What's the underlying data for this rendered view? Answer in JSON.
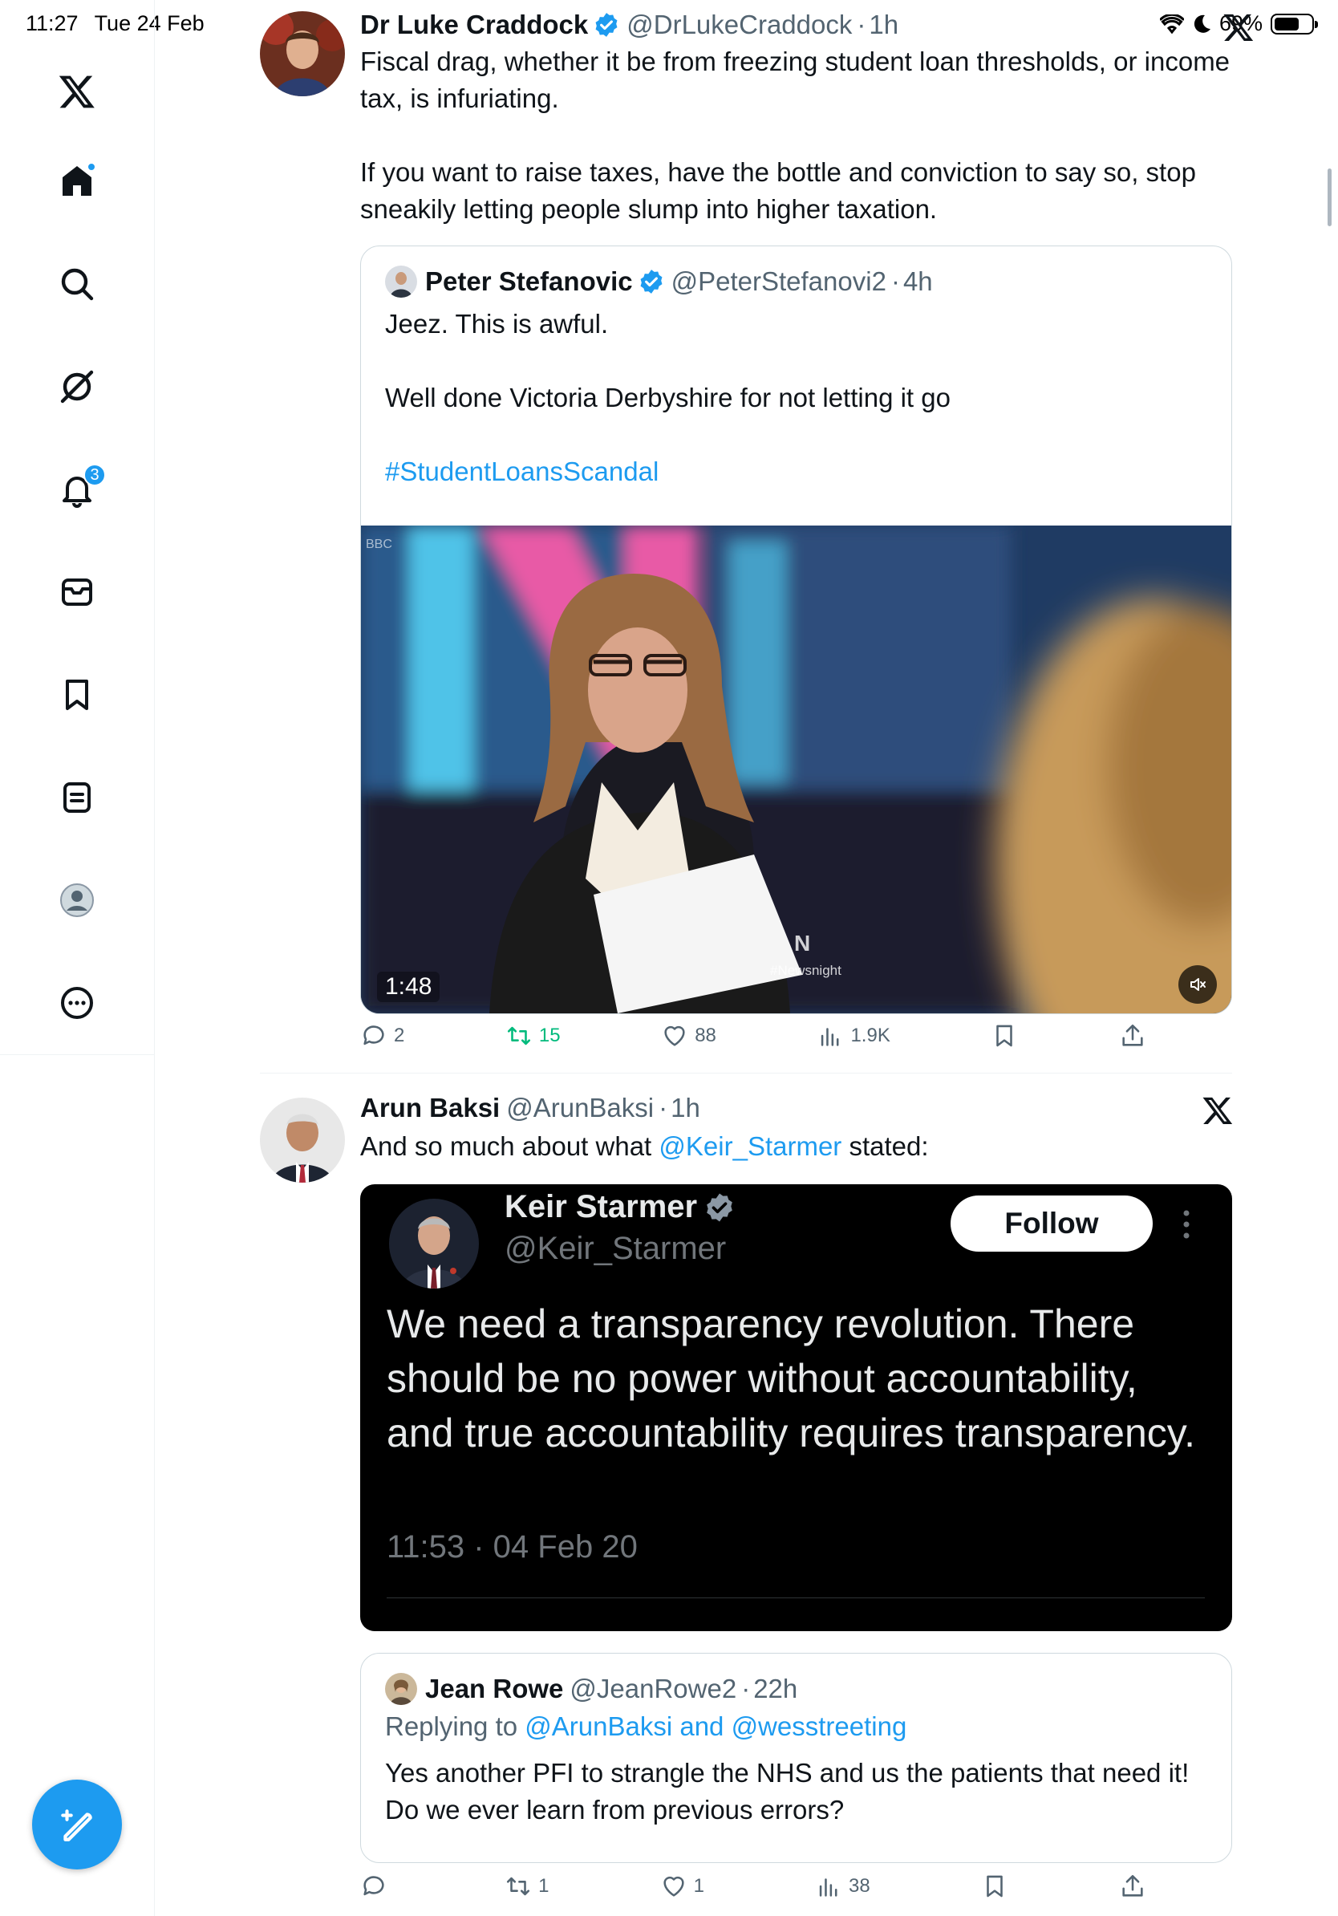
{
  "status_bar": {
    "time": "11:27",
    "date": "Tue 24 Feb",
    "battery": "69%",
    "battery_level": 0.69
  },
  "sidebar": {
    "items": [
      {
        "name": "x-logo"
      },
      {
        "name": "home",
        "has_dot": true
      },
      {
        "name": "search"
      },
      {
        "name": "grok"
      },
      {
        "name": "notifications",
        "badge": "3"
      },
      {
        "name": "messages"
      },
      {
        "name": "bookmarks"
      },
      {
        "name": "lists"
      },
      {
        "name": "profile"
      },
      {
        "name": "more"
      }
    ],
    "compose_label": "compose"
  },
  "colors": {
    "accent": "#1d9bf0",
    "retweet": "#00ba7c",
    "muted": "#536471"
  },
  "tweets": [
    {
      "author": "Dr Luke Craddock",
      "handle": "@DrLukeCraddock",
      "time": "1h",
      "verified": true,
      "text_1": "Fiscal drag, whether it be from freezing student loan thresholds, or income tax, is infuriating.",
      "text_2": "If you want to raise taxes, have the bottle and conviction to say so, stop sneakily letting people slump into higher taxation.",
      "quote": {
        "author": "Peter Stefanovic",
        "handle": "@PeterStefanovi2",
        "time": "4h",
        "verified": true,
        "text_1": "Jeez. This is awful.",
        "text_2": "Well done Victoria Derbyshire for not letting it go",
        "hashtag": "#StudentLoansScandal",
        "video": {
          "duration": "1:48",
          "watermark": "#Newsnight",
          "channel": "BBC"
        }
      },
      "actions": {
        "replies": "2",
        "retweets": "15",
        "likes": "88",
        "views": "1.9K"
      }
    },
    {
      "author": "Arun Baksi",
      "handle": "@ArunBaksi",
      "time": "1h",
      "verified": false,
      "text_prefix": "And so much about what ",
      "mention": "@Keir_Starmer",
      "text_suffix": " stated:",
      "screenshot": {
        "name": "Keir Starmer",
        "handle": "@Keir_Starmer",
        "follow_label": "Follow",
        "text": "We need a transparency revolution. There should be no power without accountability, and true accountability requires transparency.",
        "timestamp": "11:53 · 04 Feb 20"
      },
      "quote": {
        "author": "Jean Rowe",
        "handle": "@JeanRowe2",
        "time": "22h",
        "replying_prefix": "Replying to ",
        "replying_to": "@ArunBaksi and @wesstreeting",
        "text": "Yes another PFI to strangle the NHS and us the patients that need it! Do we ever learn from previous errors?"
      },
      "actions": {
        "replies": "",
        "retweets": "1",
        "likes": "1",
        "views": "38"
      }
    }
  ]
}
